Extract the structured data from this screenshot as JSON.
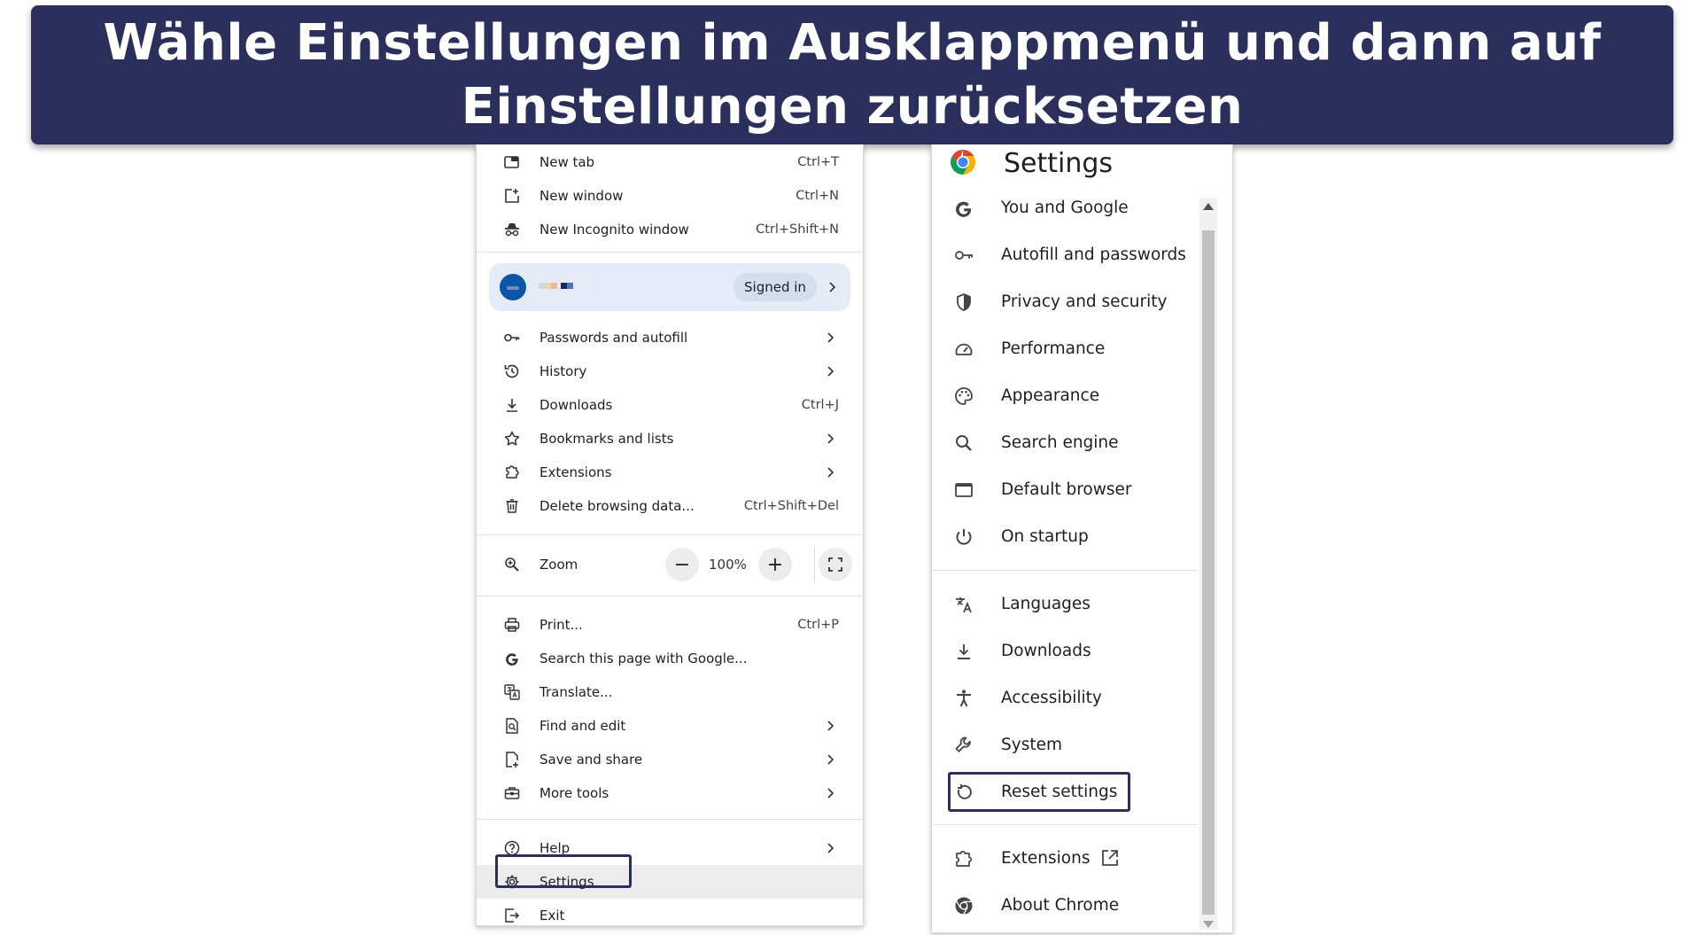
{
  "banner": {
    "text": "Wähle Einstellungen im Ausklappmenü und dann auf Einstellungen zurücksetzen"
  },
  "menu": {
    "top_items": [
      {
        "label": "New tab",
        "shortcut": "Ctrl+T",
        "icon": "new-tab-icon"
      },
      {
        "label": "New window",
        "shortcut": "Ctrl+N",
        "icon": "new-window-icon"
      },
      {
        "label": "New Incognito window",
        "shortcut": "Ctrl+Shift+N",
        "icon": "incognito-icon"
      }
    ],
    "profile": {
      "status": "Signed in",
      "avatar_color": "#0b57a6"
    },
    "mid_items": [
      {
        "label": "Passwords and autofill",
        "icon": "key-icon"
      },
      {
        "label": "History",
        "icon": "history-icon"
      },
      {
        "label": "Downloads",
        "shortcut": "Ctrl+J",
        "icon": "download-icon"
      },
      {
        "label": "Bookmarks and lists",
        "icon": "star-icon"
      },
      {
        "label": "Extensions",
        "icon": "puzzle-icon"
      },
      {
        "label": "Delete browsing data...",
        "shortcut": "Ctrl+Shift+Del",
        "icon": "trash-icon"
      }
    ],
    "zoom": {
      "label": "Zoom",
      "value": "100%",
      "minus": "−",
      "plus": "+"
    },
    "tool_items": [
      {
        "label": "Print...",
        "shortcut": "Ctrl+P",
        "icon": "printer-icon"
      },
      {
        "label": "Search this page with Google...",
        "icon": "google-g-icon"
      },
      {
        "label": "Translate...",
        "icon": "translate-icon"
      },
      {
        "label": "Find and edit",
        "icon": "find-icon"
      },
      {
        "label": "Save and share",
        "icon": "save-share-icon"
      },
      {
        "label": "More tools",
        "icon": "toolbox-icon"
      }
    ],
    "bottom_items": [
      {
        "label": "Help",
        "icon": "help-icon"
      },
      {
        "label": "Settings",
        "icon": "gear-icon"
      },
      {
        "label": "Exit",
        "icon": "exit-icon"
      }
    ]
  },
  "settings": {
    "title": "Settings",
    "group1": [
      {
        "label": "You and Google",
        "icon": "google-g-icon"
      },
      {
        "label": "Autofill and passwords",
        "icon": "key-icon"
      },
      {
        "label": "Privacy and security",
        "icon": "shield-icon"
      },
      {
        "label": "Performance",
        "icon": "speedometer-icon"
      },
      {
        "label": "Appearance",
        "icon": "palette-icon"
      },
      {
        "label": "Search engine",
        "icon": "search-icon"
      },
      {
        "label": "Default browser",
        "icon": "browser-window-icon"
      },
      {
        "label": "On startup",
        "icon": "power-icon"
      }
    ],
    "group2": [
      {
        "label": "Languages",
        "icon": "translate-icon"
      },
      {
        "label": "Downloads",
        "icon": "download-icon"
      },
      {
        "label": "Accessibility",
        "icon": "accessibility-icon"
      },
      {
        "label": "System",
        "icon": "wrench-icon"
      },
      {
        "label": "Reset settings",
        "icon": "reset-icon"
      }
    ],
    "group3": [
      {
        "label": "Extensions",
        "icon": "puzzle-icon"
      },
      {
        "label": "About Chrome",
        "icon": "chrome-icon"
      }
    ]
  },
  "colors": {
    "banner_bg": "#2b2f5c",
    "highlight_box": "#2b2f5c",
    "profile_bg": "#e6ecf7",
    "signed_in_chip": "#d3deef"
  }
}
